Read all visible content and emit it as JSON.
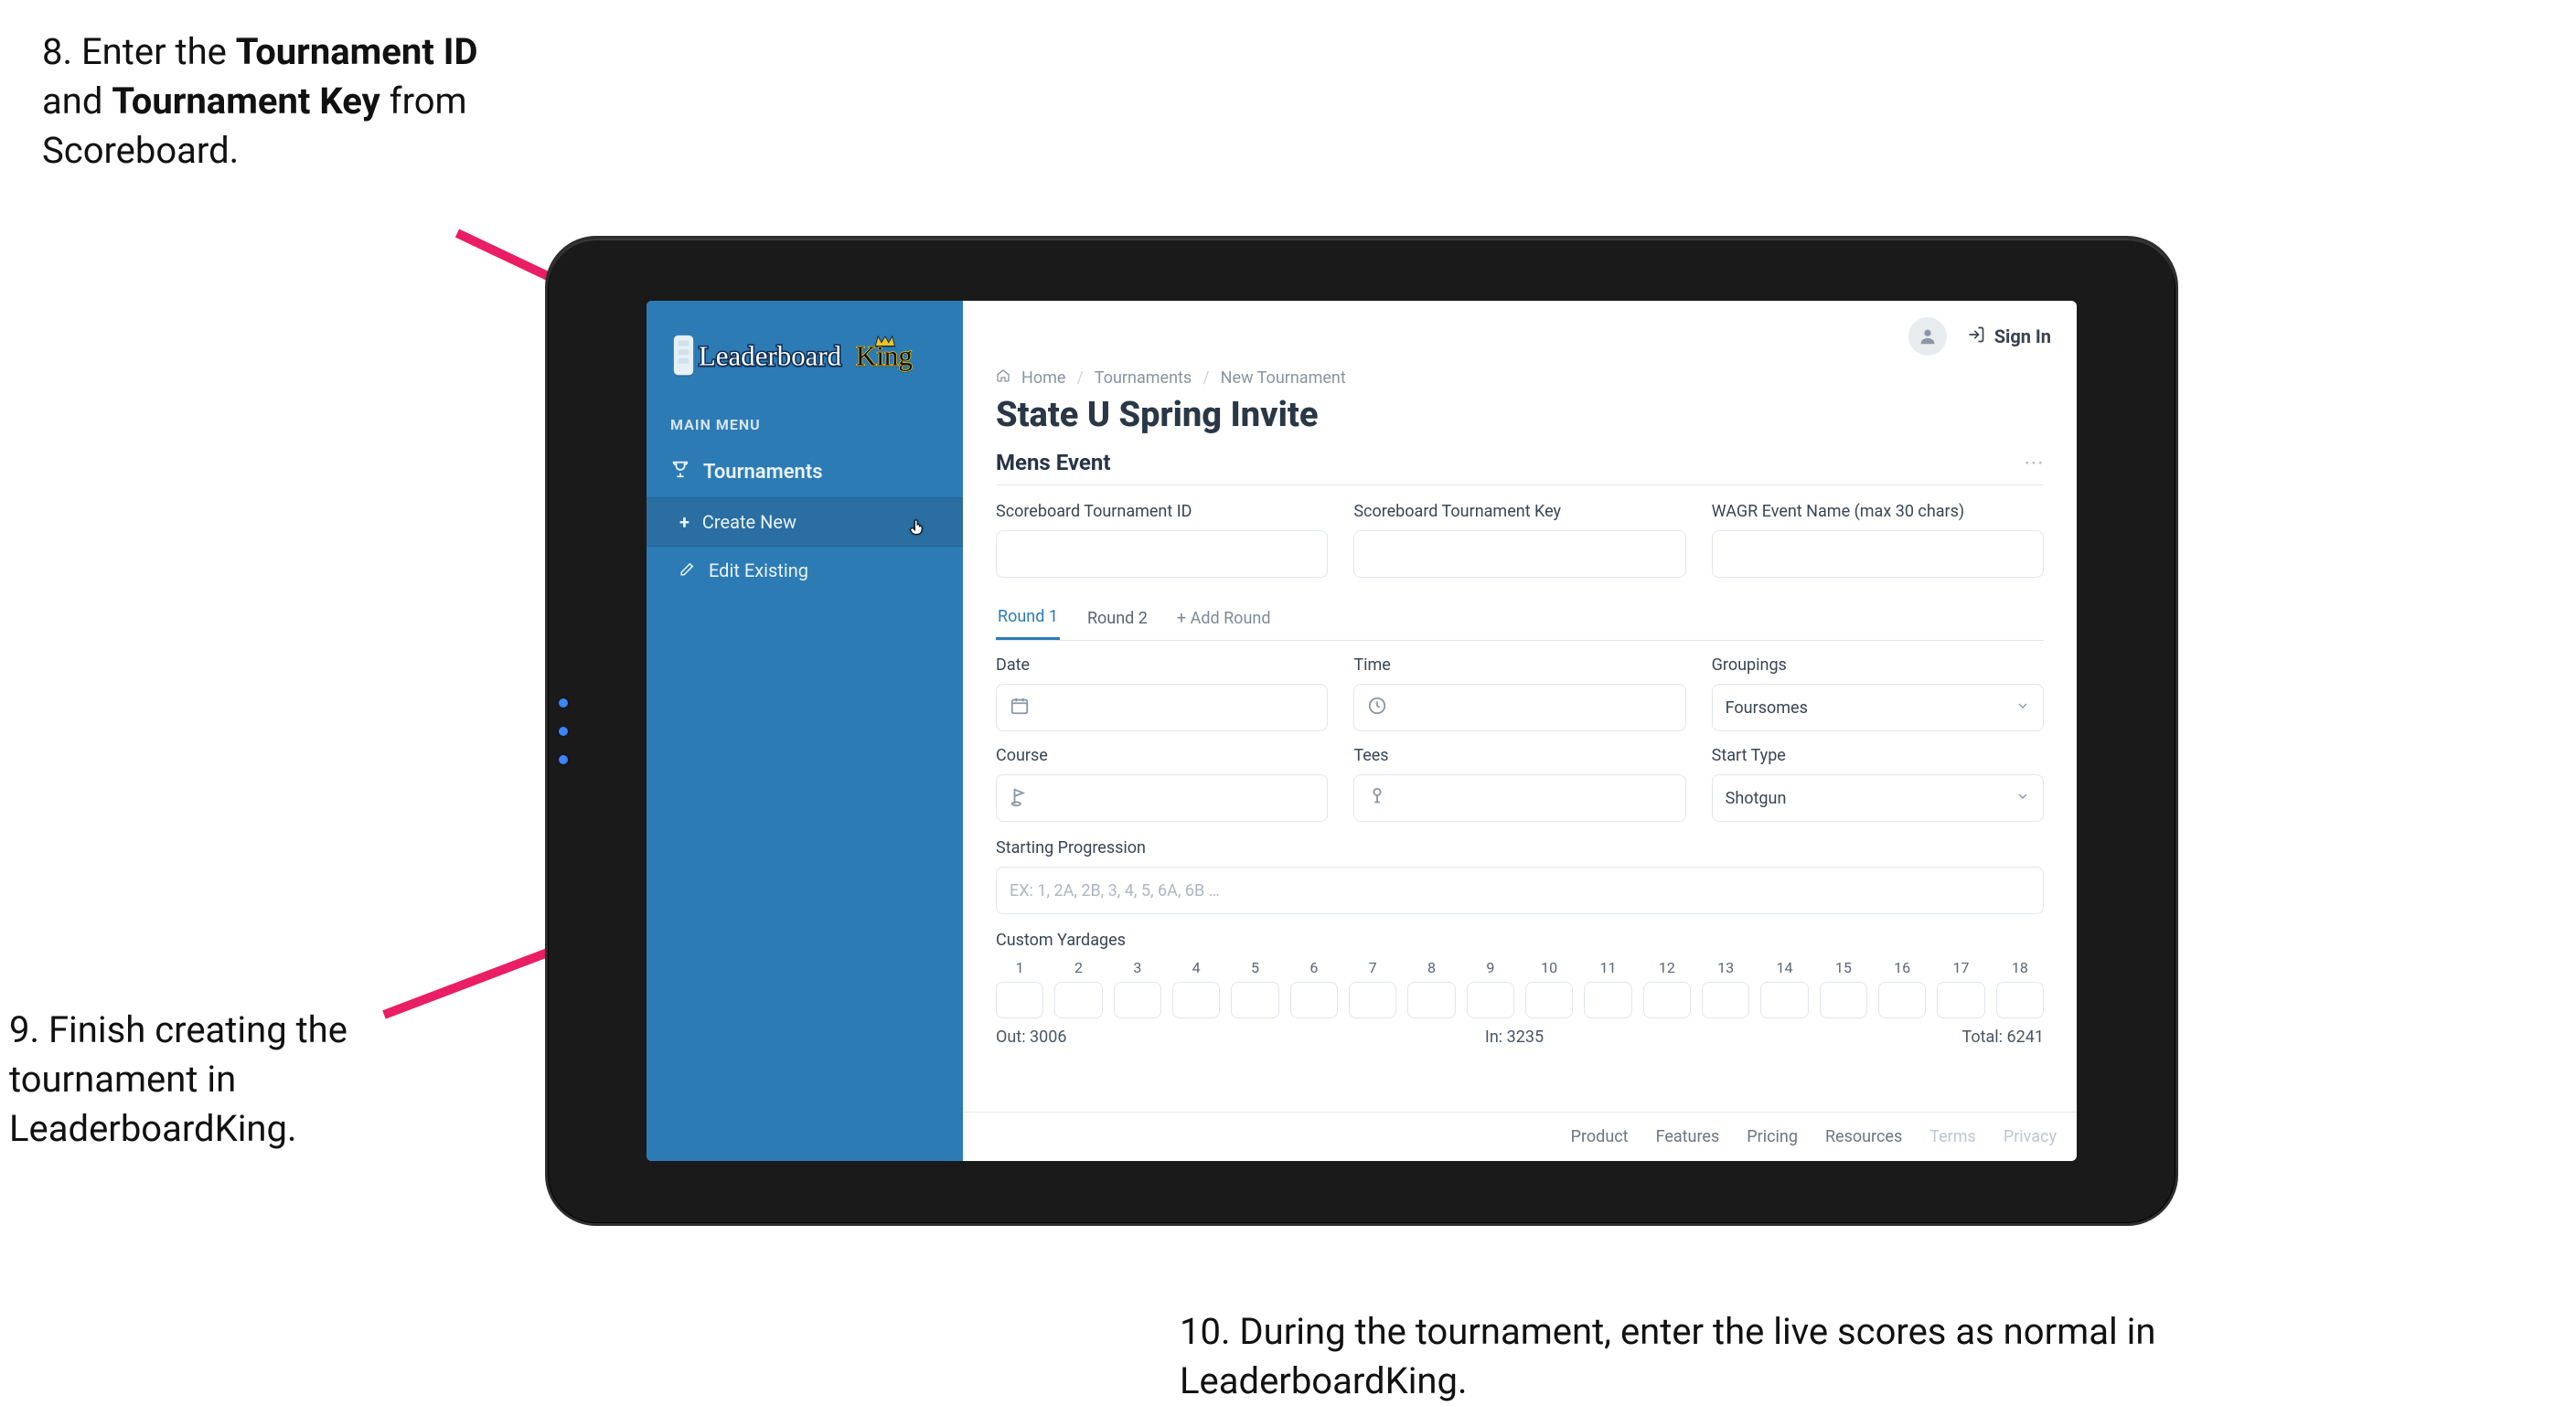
{
  "annotations": {
    "step8": {
      "pre": "8. Enter the ",
      "b1": "Tournament ID",
      "mid": " and ",
      "b2": "Tournament Key",
      "post": " from Scoreboard."
    },
    "step9": "9. Finish creating the tournament in LeaderboardKing.",
    "step10": "10. During the tournament, enter the live scores as normal in LeaderboardKing."
  },
  "app": {
    "brand_name": "LeaderboardKing",
    "topbar": {
      "sign_in": "Sign In"
    }
  },
  "sidebar": {
    "menu_label": "MAIN MENU",
    "items": {
      "tournaments": "Tournaments",
      "create_new": "Create New",
      "edit_existing": "Edit Existing"
    }
  },
  "breadcrumbs": {
    "home": "Home",
    "tournaments": "Tournaments",
    "new_tournament": "New Tournament"
  },
  "page": {
    "title": "State U Spring Invite",
    "event_title": "Mens Event"
  },
  "fields": {
    "sb_tournament_id": "Scoreboard Tournament ID",
    "sb_tournament_key": "Scoreboard Tournament Key",
    "wagr_event_name": "WAGR Event Name (max 30 chars)",
    "date": "Date",
    "time": "Time",
    "groupings": "Groupings",
    "groupings_value": "Foursomes",
    "course": "Course",
    "tees": "Tees",
    "start_type": "Start Type",
    "start_type_value": "Shotgun",
    "starting_progression": "Starting Progression",
    "starting_progression_placeholder": "EX: 1, 2A, 2B, 3, 4, 5, 6A, 6B …",
    "custom_yardages": "Custom Yardages"
  },
  "tabs": {
    "round1": "Round 1",
    "round2": "Round 2",
    "add_round": "+ Add Round"
  },
  "yardages": {
    "out_label": "Out:",
    "out_value": "3006",
    "in_label": "In:",
    "in_value": "3235",
    "total_label": "Total:",
    "total_value": "6241",
    "holes": [
      "1",
      "2",
      "3",
      "4",
      "5",
      "6",
      "7",
      "8",
      "9",
      "10",
      "11",
      "12",
      "13",
      "14",
      "15",
      "16",
      "17",
      "18"
    ]
  },
  "footer": {
    "product": "Product",
    "features": "Features",
    "pricing": "Pricing",
    "resources": "Resources",
    "terms": "Terms",
    "privacy": "Privacy"
  }
}
